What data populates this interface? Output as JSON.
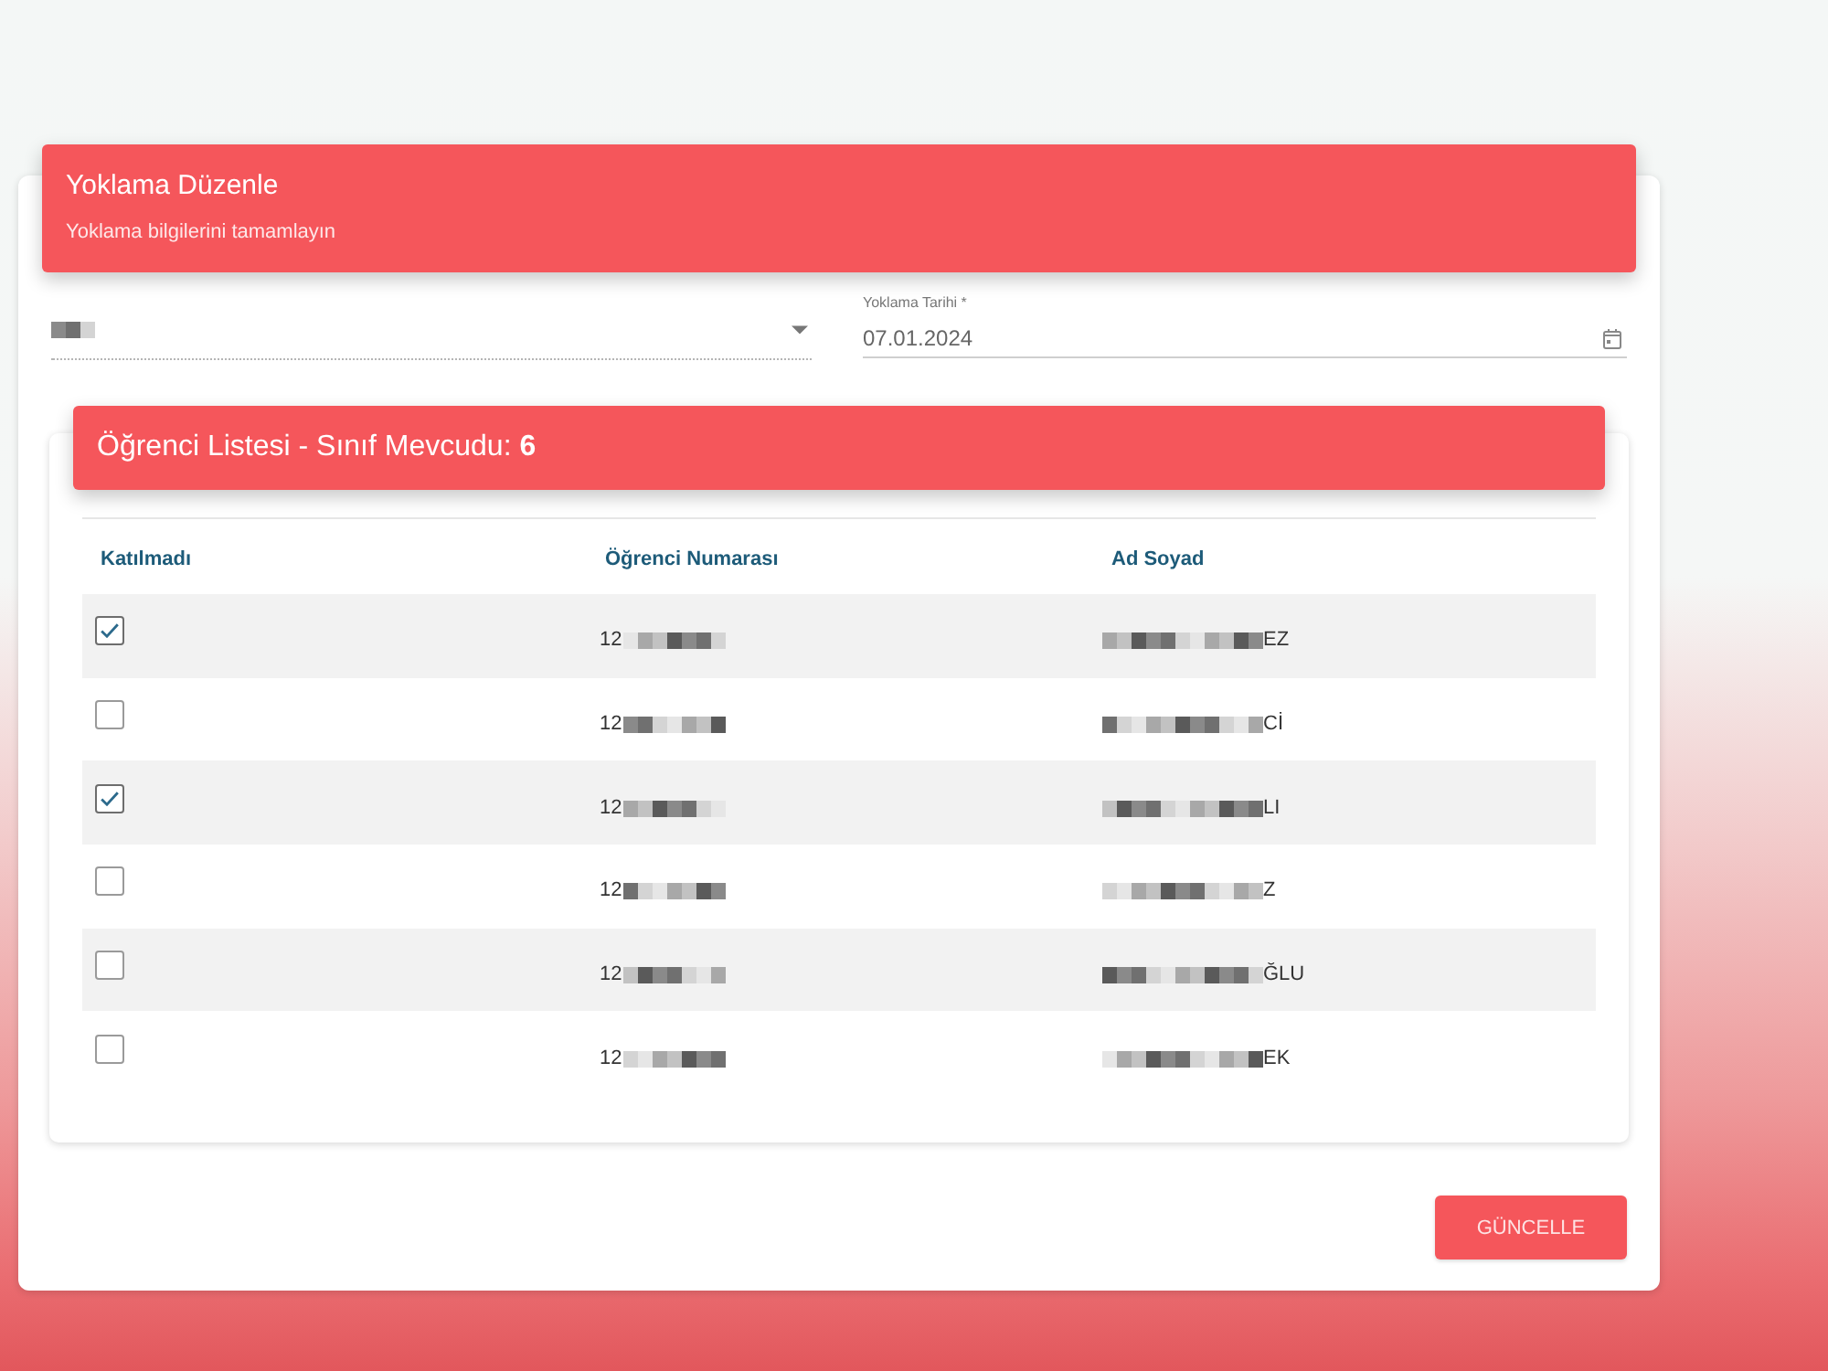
{
  "header": {
    "title": "Yoklama Düzenle",
    "subtitle": "Yoklama bilgilerini tamamlayın"
  },
  "class_select": {
    "value_pixelated": true
  },
  "date_field": {
    "label": "Yoklama Tarihi *",
    "value": "07.01.2024"
  },
  "student_list": {
    "title": "Öğrenci Listesi - Sınıf Mevcudu: **6**",
    "columns": [
      "Katılmadı",
      "Öğrenci Numarası",
      "Ad Soyad"
    ],
    "rows": [
      {
        "checked": true,
        "number": "12",
        "name": "EZ",
        "pixelated": true
      },
      {
        "checked": false,
        "number": "12",
        "name": "Cİ",
        "pixelated": true
      },
      {
        "checked": true,
        "number": "12",
        "name": "LI",
        "pixelated": true
      },
      {
        "checked": false,
        "number": "12",
        "name": "Z",
        "pixelated": true
      },
      {
        "checked": false,
        "number": "12",
        "name": "ĞLU",
        "pixelated": true
      },
      {
        "checked": false,
        "number": "12",
        "name": "EK",
        "pixelated": true
      }
    ]
  },
  "buttons": [
    "GÜNCELLE"
  ]
}
